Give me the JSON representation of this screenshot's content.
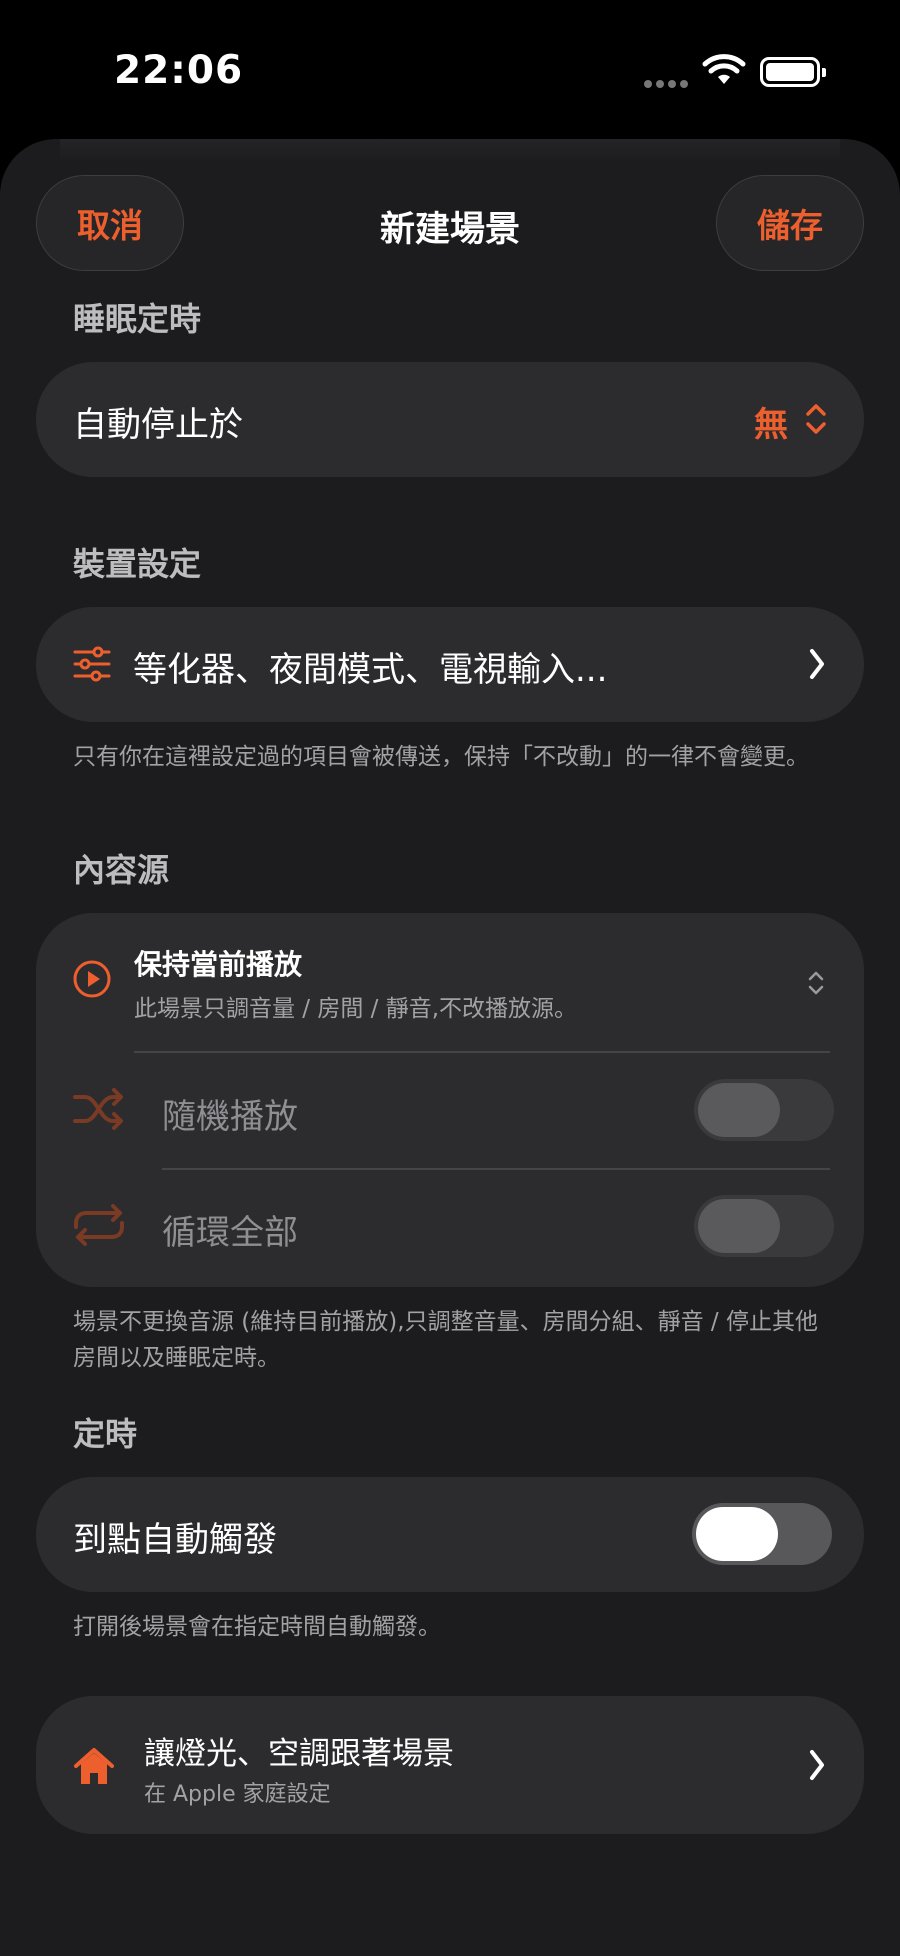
{
  "status": {
    "time": "22:06"
  },
  "nav": {
    "cancel": "取消",
    "title": "新建場景",
    "save": "儲存"
  },
  "sleep_timer": {
    "header": "睡眠定時",
    "row_label": "自動停止於",
    "value": "無"
  },
  "device_settings": {
    "header": "裝置設定",
    "row_label": "等化器、夜間模式、電視輸入...",
    "footnote": "只有你在這裡設定過的項目會被傳送，保持「不改動」的一律不會變更。"
  },
  "content_source": {
    "header": "內容源",
    "title": "保持當前播放",
    "subtitle": "此場景只調音量 / 房間 / 靜音,不改播放源。",
    "shuffle_label": "隨機播放",
    "shuffle_on": false,
    "repeat_label": "循環全部",
    "repeat_on": false,
    "footnote": "場景不更換音源 (維持目前播放),只調整音量、房間分組、靜音 / 停止其他房間以及睡眠定時。"
  },
  "schedule": {
    "header": "定時",
    "row_label": "到點自動觸發",
    "toggle_on": false,
    "footnote": "打開後場景會在指定時間自動觸發。"
  },
  "home": {
    "title": "讓燈光、空調跟著場景",
    "subtitle": "在 Apple 家庭設定"
  },
  "colors": {
    "accent": "#ee5f2e",
    "background": "#1c1c1e",
    "card": "#2c2c2e"
  },
  "icons": {
    "status": [
      "cellular-dots-icon",
      "wifi-icon",
      "battery-icon"
    ],
    "rows": [
      "sliders-icon",
      "play-circle-icon",
      "shuffle-icon",
      "repeat-icon",
      "house-icon",
      "chevron-right-icon",
      "up-down-chevron-icon"
    ]
  }
}
